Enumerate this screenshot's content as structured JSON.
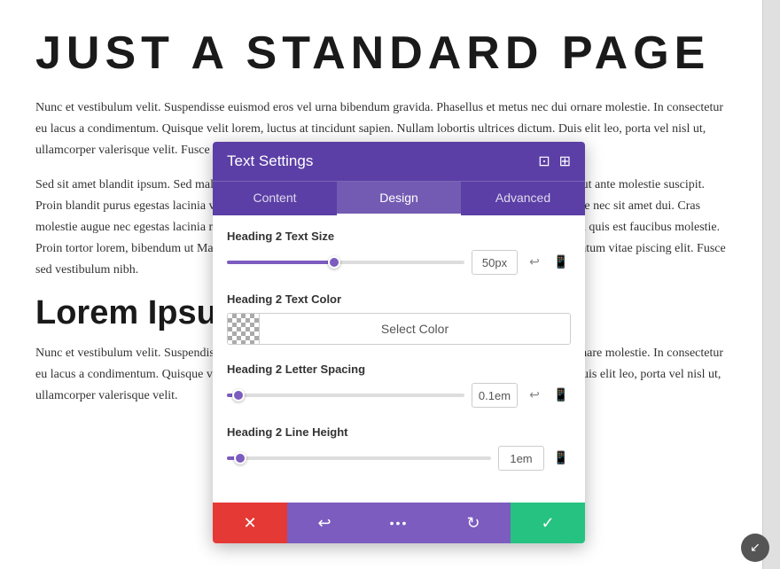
{
  "page": {
    "title": "JUST A STANDARD PAGE",
    "text1": "Nunc et vestibulum velit. Suspendisse euismod eros vel urna bibendum gravida. Phasellus et metus nec dui ornare molestie. In consectetur eu lacus a condimentum. Quisque velit lorem, luctus at tincidunt sapien. Nullam lobortis ultrices dictum. Duis elit leo, porta vel nisl ut, ullamcorper valerisque velit. Fusce volutpat purus dui, at ultrices eros elementum sit amet euismod justo.",
    "text2": "Sed sit amet blandit ipsum. Sed malesuada, arcu in sodales placerat, velit sem vehicula sem. Morbi vitae odio ut ante molestie suscipit. Proin blandit purus egestas lacinia varius. Aliquam imperdiet dui a purus mollis condimentum. Nullam nec ante nec sit amet dui. Cras molestie augue nec egestas lacinia mauris, bibendum a mollis a, laoreet justo. Mauris quada vel. Nam ut ipsum quis est faucibus molestie. Proin tortor lorem, bibendum ut Maecenas nunc felis, aliquet ac feugiat ac, bibendum a varius. Ultrices elementum vitae piscing elit. Fusce sed vestibulum nibh.",
    "lorem_heading": "Lorem Ipsum D",
    "text3": "Nunc et vestibulum velit. Suspendisse euismod eros vel urna bibendum gravida. Phasellus et metus nec dui ornare molestie. In consectetur eu lacus a condimentum. Quisque velit lorem, luctus at tincidunt sapien. Nullam lobortis ultrices bibendum. Duis elit leo, porta vel nisl ut, ullamcorper valerisque velit."
  },
  "panel": {
    "title": "Text Settings",
    "tabs": [
      {
        "label": "Content",
        "active": false
      },
      {
        "label": "Design",
        "active": true
      },
      {
        "label": "Advanced",
        "active": false
      }
    ],
    "settings": {
      "text_size": {
        "label": "Heading 2 Text Size",
        "value": "50px",
        "slider_percent": 45
      },
      "text_color": {
        "label": "Heading 2 Text Color",
        "button_label": "Select Color"
      },
      "letter_spacing": {
        "label": "Heading 2 Letter Spacing",
        "value": "0.1em",
        "slider_percent": 5
      },
      "line_height": {
        "label": "Heading 2 Line Height",
        "value": "1em",
        "slider_percent": 5
      }
    },
    "actions": {
      "cancel": "✕",
      "reset": "↩",
      "more": "•••",
      "redo": "↻",
      "confirm": "✓"
    }
  }
}
